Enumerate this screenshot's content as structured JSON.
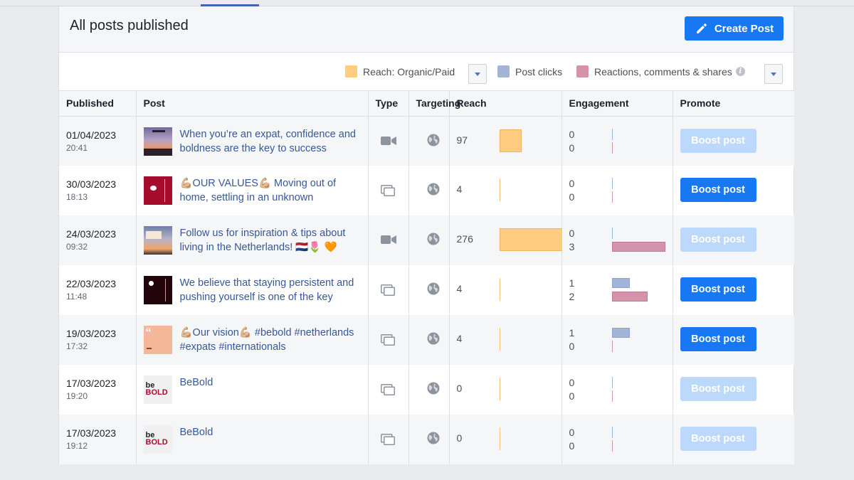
{
  "header": {
    "title": "All posts published",
    "create_post_label": "Create Post"
  },
  "legend": {
    "items": [
      {
        "label": "Reach: Organic/Paid",
        "color": "#ffcc80"
      },
      {
        "label": "Post clicks",
        "color": "#a3b5d6"
      },
      {
        "label": "Reactions, comments & shares",
        "color": "#d493aa"
      }
    ],
    "info_icon_glyph": "i"
  },
  "columns": [
    "Published",
    "Post",
    "Type",
    "Targeting",
    "Reach",
    "Engagement",
    "Promote"
  ],
  "boost_label": "Boost post",
  "rows": [
    {
      "date": "01/04/2023",
      "time": "20:41",
      "text": "When you’re an expat, confidence and boldness are the key to success",
      "type": "video-icon",
      "reach": "97",
      "reach_fraction": 0.35,
      "clicks": "0",
      "reactions": "0",
      "clicks_fraction": 0,
      "reactions_fraction": 0,
      "boost_enabled": false,
      "thumb": "sunset"
    },
    {
      "date": "30/03/2023",
      "time": "18:13",
      "text": "💪🏼OUR VALUES💪🏼 Moving out of home, settling in an unknown",
      "type": "multi-photo-icon",
      "reach": "4",
      "reach_fraction": 0,
      "clicks": "0",
      "reactions": "0",
      "clicks_fraction": 0,
      "reactions_fraction": 0,
      "boost_enabled": true,
      "thumb": "red"
    },
    {
      "date": "24/03/2023",
      "time": "09:32",
      "text": "Follow us for inspiration & tips about living in the Netherlands! 🇳🇱🌷 🧡",
      "type": "video-icon",
      "reach": "276",
      "reach_fraction": 1,
      "clicks": "0",
      "reactions": "3",
      "clicks_fraction": 0,
      "reactions_fraction": 1,
      "boost_enabled": false,
      "thumb": "sky"
    },
    {
      "date": "22/03/2023",
      "time": "11:48",
      "text": "We believe that staying persistent and pushing yourself is one of the key",
      "type": "multi-photo-icon",
      "reach": "4",
      "reach_fraction": 0,
      "clicks": "1",
      "reactions": "2",
      "clicks_fraction": 0.33,
      "reactions_fraction": 0.67,
      "boost_enabled": true,
      "thumb": "dark"
    },
    {
      "date": "19/03/2023",
      "time": "17:32",
      "text": "💪🏼Our vision💪🏼 #bebold #netherlands #expats #internationals",
      "type": "multi-photo-icon",
      "reach": "4",
      "reach_fraction": 0,
      "clicks": "1",
      "reactions": "0",
      "clicks_fraction": 0.33,
      "reactions_fraction": 0,
      "boost_enabled": true,
      "thumb": "peach"
    },
    {
      "date": "17/03/2023",
      "time": "19:20",
      "text": "BeBold",
      "type": "multi-photo-icon",
      "reach": "0",
      "reach_fraction": 0,
      "clicks": "0",
      "reactions": "0",
      "clicks_fraction": 0,
      "reactions_fraction": 0,
      "boost_enabled": false,
      "thumb": "logo"
    },
    {
      "date": "17/03/2023",
      "time": "19:12",
      "text": "BeBold",
      "type": "multi-photo-icon",
      "reach": "0",
      "reach_fraction": 0,
      "clicks": "0",
      "reactions": "0",
      "clicks_fraction": 0,
      "reactions_fraction": 0,
      "boost_enabled": false,
      "thumb": "logo"
    }
  ],
  "logo_text": {
    "top": "be",
    "bottom": "BOLD"
  }
}
